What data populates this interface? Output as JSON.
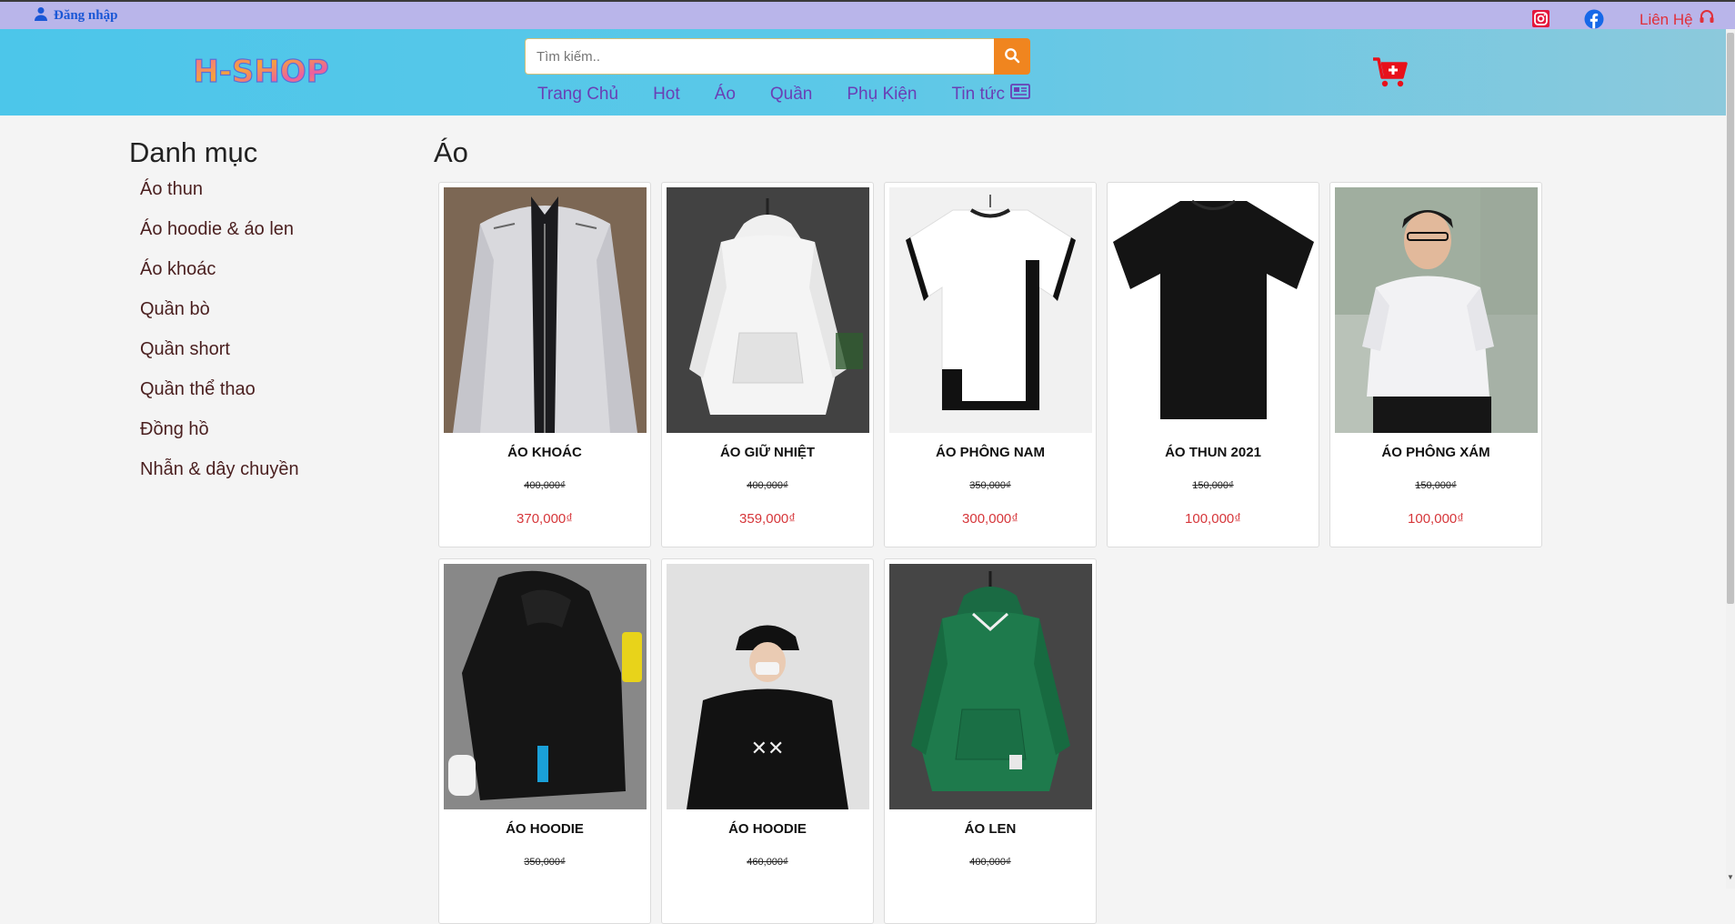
{
  "topbar": {
    "login_label": "Đăng nhập",
    "contact_label": "Liên Hệ"
  },
  "header": {
    "logo_text": "H-SHOP",
    "search_placeholder": "Tìm kiếm..",
    "nav": [
      "Trang Chủ",
      "Hot",
      "Áo",
      "Quần",
      "Phụ Kiện",
      "Tin tức"
    ]
  },
  "sidebar": {
    "title": "Danh mục",
    "categories": [
      "Áo thun",
      "Áo hoodie & áo len",
      "Áo khoác",
      "Quần bò",
      "Quần short",
      "Quần thể thao",
      "Đồng hồ",
      "Nhẫn & dây chuyền"
    ]
  },
  "main": {
    "title": "Áo",
    "products": [
      {
        "name": "ÁO KHOÁC",
        "old_price": "400,000₫",
        "price": "370,000₫"
      },
      {
        "name": "ÁO GIỮ NHIỆT",
        "old_price": "400,000₫",
        "price": "359,000₫"
      },
      {
        "name": "ÁO PHÔNG NAM",
        "old_price": "350,000₫",
        "price": "300,000₫"
      },
      {
        "name": "ÁO THUN 2021",
        "old_price": "150,000₫",
        "price": "100,000₫"
      },
      {
        "name": "ÁO PHÔNG XÁM",
        "old_price": "150,000₫",
        "price": "100,000₫"
      },
      {
        "name": "ÁO HOODIE",
        "old_price": "350,000₫",
        "price": ""
      },
      {
        "name": "ÁO HOODIE",
        "old_price": "460,000₫",
        "price": ""
      },
      {
        "name": "ÁO LEN",
        "old_price": "400,000₫",
        "price": ""
      }
    ]
  },
  "icons": {
    "user": "user-icon",
    "instagram": "instagram-icon",
    "facebook": "facebook-icon",
    "headset": "headset-icon",
    "search": "search-icon",
    "news": "newspaper-icon",
    "cart": "cart-plus-icon"
  },
  "colors": {
    "topbar_bg": "#b9b5ea",
    "header_bg": "#4cc6ea",
    "search_button": "#f0851f",
    "nav_text": "#6a3fb5",
    "price_red": "#d6363a",
    "cart_red": "#e8101a",
    "login_blue": "#1a57d6"
  }
}
